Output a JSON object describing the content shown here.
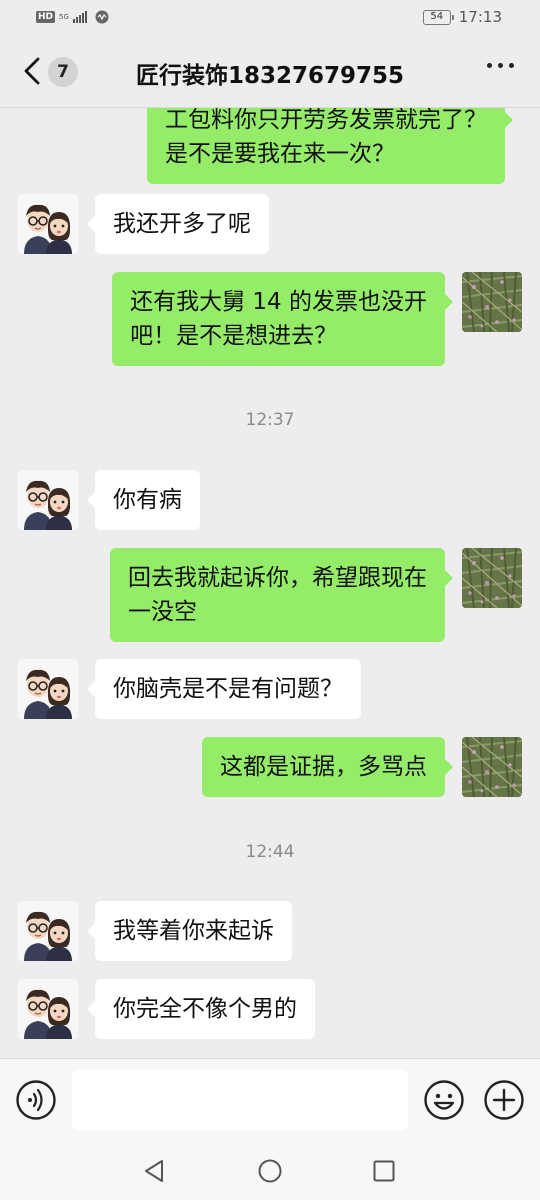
{
  "status_bar": {
    "hd": "HD",
    "network": "5G",
    "battery": "54",
    "time": "17:13"
  },
  "header": {
    "unread_count": "7",
    "title": "匠行装饰18327679755",
    "back_icon": "chevron-left-icon",
    "more_icon": "more-dots-icon"
  },
  "messages": [
    {
      "side": "right",
      "lines": [
        "工包料你只开劳务发票就完了？",
        "是不是要我在来一次？"
      ],
      "avatar": "grass-avatar"
    },
    {
      "side": "left",
      "lines": [
        "我还开多了呢"
      ],
      "avatar": "couple-cartoon-avatar"
    },
    {
      "side": "right",
      "lines": [
        "还有我大舅 14 的发票也没开",
        "吧！是不是想进去？"
      ],
      "avatar": "grass-avatar"
    },
    {
      "time": "12:37"
    },
    {
      "side": "left",
      "lines": [
        "你有病"
      ],
      "avatar": "couple-cartoon-avatar"
    },
    {
      "side": "right",
      "lines": [
        "回去我就起诉你，希望跟现在",
        "一没空"
      ],
      "avatar": "grass-avatar"
    },
    {
      "side": "left",
      "lines": [
        "你脑壳是不是有问题？"
      ],
      "avatar": "couple-cartoon-avatar"
    },
    {
      "side": "right",
      "lines": [
        "这都是证据，多骂点"
      ],
      "avatar": "grass-avatar"
    },
    {
      "time": "12:44"
    },
    {
      "side": "left",
      "lines": [
        "我等着你来起诉"
      ],
      "avatar": "couple-cartoon-avatar"
    },
    {
      "side": "left",
      "lines": [
        "你完全不像个男的"
      ],
      "avatar": "couple-cartoon-avatar"
    }
  ],
  "input_bar": {
    "value": "",
    "voice_icon": "voice-icon",
    "emoji_icon": "emoji-icon",
    "plus_icon": "plus-icon"
  },
  "nav_bar": {
    "back_icon": "nav-back-icon",
    "home_icon": "nav-home-icon",
    "recent_icon": "nav-recent-icon"
  },
  "colors": {
    "background": "#ededed",
    "bubble_self": "#95ec69",
    "bubble_other": "#ffffff",
    "time_text": "#8a8a8a"
  }
}
